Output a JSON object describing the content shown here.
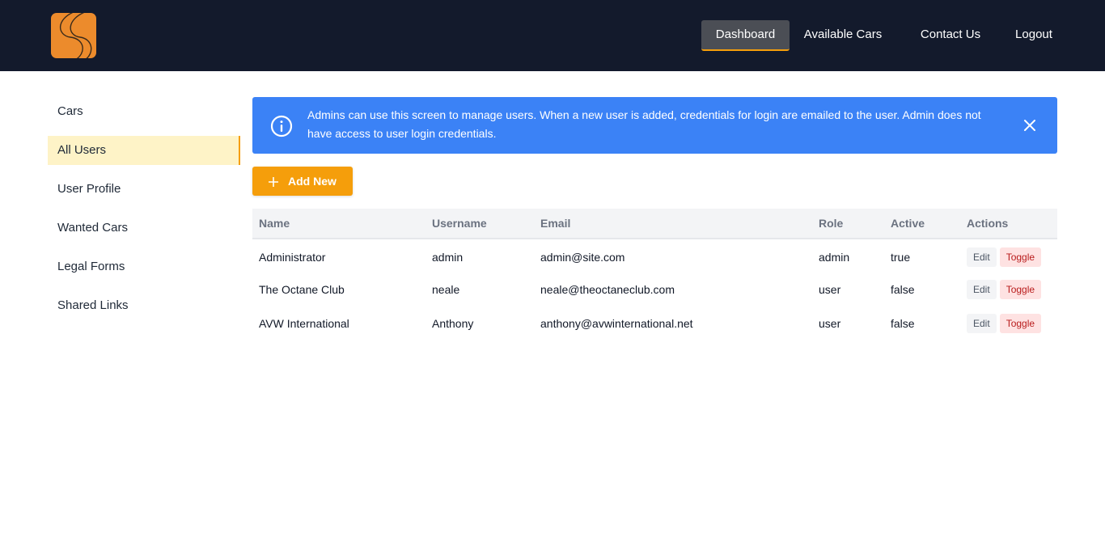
{
  "nav": {
    "items": [
      {
        "label": "Dashboard",
        "active": true
      },
      {
        "label": "Available Cars",
        "active": false
      },
      {
        "label": "Contact Us",
        "active": false
      },
      {
        "label": "Logout",
        "active": false
      }
    ]
  },
  "sidebar": {
    "items": [
      {
        "label": "Cars",
        "active": false
      },
      {
        "label": "All Users",
        "active": true
      },
      {
        "label": "User Profile",
        "active": false
      },
      {
        "label": "Wanted Cars",
        "active": false
      },
      {
        "label": "Legal Forms",
        "active": false
      },
      {
        "label": "Shared Links",
        "active": false
      }
    ]
  },
  "alert": {
    "icon": "info-icon",
    "text": "Admins can use this screen to manage users. When a new user is added, credentials for login are emailed to the user. Admin does not have access to user login credentials.",
    "close_icon": "close-icon"
  },
  "add_button": {
    "label": "Add New",
    "icon": "plus-icon"
  },
  "table": {
    "headers": [
      "Name",
      "Username",
      "Email",
      "Role",
      "Active",
      "Actions"
    ],
    "rows": [
      {
        "name": "Administrator",
        "username": "admin",
        "email": "admin@site.com",
        "role": "admin",
        "active": "true"
      },
      {
        "name": "The Octane Club",
        "username": "neale",
        "email": "neale@theoctaneclub.com",
        "role": "user",
        "active": "false"
      },
      {
        "name": "AVW International",
        "username": "Anthony",
        "email": "anthony@avwinternational.net",
        "role": "user",
        "active": "false"
      }
    ],
    "edit_label": "Edit",
    "toggle_label": "Toggle"
  },
  "colors": {
    "topbar": "#131a2c",
    "accent": "#f59e0b",
    "alert": "#3b82f6",
    "logo": "#ec8b2c"
  }
}
